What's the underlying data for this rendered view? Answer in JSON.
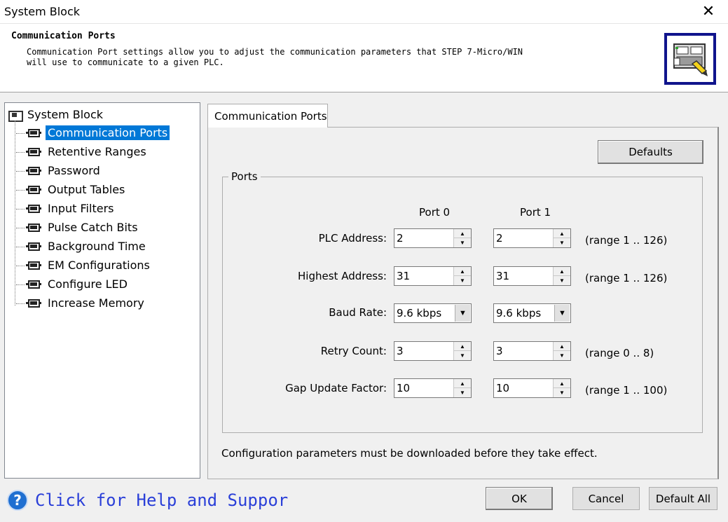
{
  "window": {
    "title": "System Block",
    "close_glyph": "✕"
  },
  "header": {
    "title": "Communication Ports",
    "description": "Communication Port settings allow you to adjust the communication parameters that STEP 7-Micro/WIN\nwill use to communicate to a given PLC.",
    "icon": "plc-config-icon"
  },
  "tree": {
    "root": "System Block",
    "items": [
      {
        "label": "Communication Ports",
        "selected": true
      },
      {
        "label": "Retentive Ranges"
      },
      {
        "label": "Password"
      },
      {
        "label": "Output Tables"
      },
      {
        "label": "Input Filters"
      },
      {
        "label": "Pulse Catch Bits"
      },
      {
        "label": "Background Time"
      },
      {
        "label": "EM Configurations"
      },
      {
        "label": "Configure LED"
      },
      {
        "label": "Increase Memory"
      }
    ]
  },
  "tab": {
    "label": "Communication Ports"
  },
  "defaults_button": "Defaults",
  "ports": {
    "group_label": "Ports",
    "col0": "Port 0",
    "col1": "Port 1",
    "rows": [
      {
        "label": "PLC Address:",
        "port0": "2",
        "port1": "2",
        "range": "(range 1 .. 126)"
      },
      {
        "label": "Highest Address:",
        "port0": "31",
        "port1": "31",
        "range": "(range 1 .. 126)"
      },
      {
        "label": "Baud Rate:",
        "port0": "9.6 kbps",
        "port1": "9.6 kbps",
        "range": ""
      },
      {
        "label": "Retry Count:",
        "port0": "3",
        "port1": "3",
        "range": "(range 0 .. 8)"
      },
      {
        "label": "Gap Update Factor:",
        "port0": "10",
        "port1": "10",
        "range": "(range 1 .. 100)"
      }
    ]
  },
  "note": "Configuration parameters must be downloaded before they take effect.",
  "help_link": "Click for Help and Suppor",
  "footer": {
    "ok": "OK",
    "cancel": "Cancel",
    "default_all": "Default All"
  },
  "colors": {
    "selection": "#0078d7",
    "header_icon_border": "#10148c",
    "help_link": "#2a3fd8"
  }
}
